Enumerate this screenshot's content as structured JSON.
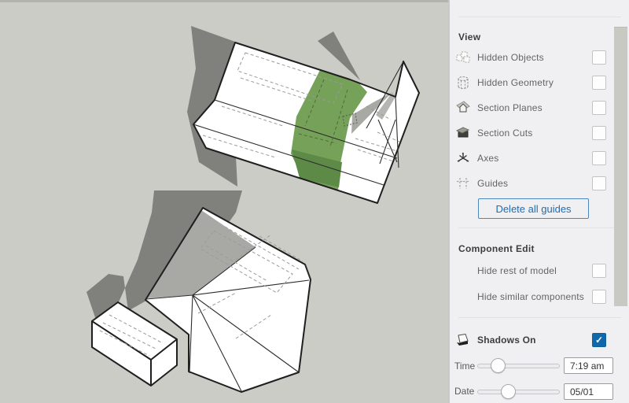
{
  "canvas": {
    "bg": "#cbccc6",
    "top_strip": "#b2b3ae",
    "shadow": "#80817d",
    "face_white": "#ffffff",
    "roof_shade": "#a8a9a5",
    "roof_shade_light": "#b5b6b2",
    "green_light": "#76a158",
    "green_dark": "#5d8a47"
  },
  "panel": {
    "view": {
      "heading": "View",
      "items": [
        {
          "label": "Hidden Objects",
          "icon": "hidden-objects-icon",
          "checked": false
        },
        {
          "label": "Hidden Geometry",
          "icon": "hidden-geometry-icon",
          "checked": false
        },
        {
          "label": "Section Planes",
          "icon": "section-planes-icon",
          "checked": false
        },
        {
          "label": "Section Cuts",
          "icon": "section-cuts-icon",
          "checked": false
        },
        {
          "label": "Axes",
          "icon": "axes-icon",
          "checked": false
        },
        {
          "label": "Guides",
          "icon": "guides-icon",
          "checked": false
        }
      ],
      "delete_guides_label": "Delete all guides"
    },
    "component_edit": {
      "heading": "Component Edit",
      "items": [
        {
          "label": "Hide rest of model",
          "checked": false
        },
        {
          "label": "Hide similar components",
          "checked": false
        }
      ]
    },
    "shadows": {
      "label": "Shadows On",
      "checked": true,
      "check_glyph": "✓",
      "accent": "#1068ab",
      "time": {
        "label": "Time",
        "value": "7:19 am",
        "slider_pos": 0.24
      },
      "date": {
        "label": "Date",
        "value": "05/01",
        "slider_pos": 0.37
      }
    }
  }
}
